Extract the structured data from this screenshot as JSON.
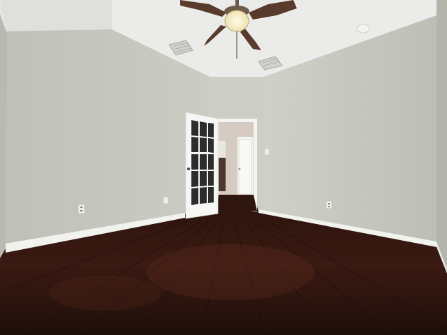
{
  "scene": {
    "description_hidden": "",
    "colors": {
      "ceiling": "#e8e9e6",
      "left_wall": "#c7c8bf",
      "back_wall": "#cfd0c8",
      "right_wall": "#c6c7bf",
      "floor_dark": "#1f0f0b",
      "floor_mid": "#3a1a12",
      "baseboard": "#f2f2ef",
      "door_frame": "#f4f4f2",
      "door_glass": "#2a2a2a",
      "hall_wall": "#d8cfc6",
      "fan_blade": "#5a3a2a",
      "fan_light": "#f6e9b8",
      "outlet": "#eeeeea"
    },
    "icons": [
      "ceiling-fan-icon",
      "ac-vent-icon",
      "light-switch-icon",
      "power-outlet-icon",
      "smoke-detector-icon"
    ]
  }
}
